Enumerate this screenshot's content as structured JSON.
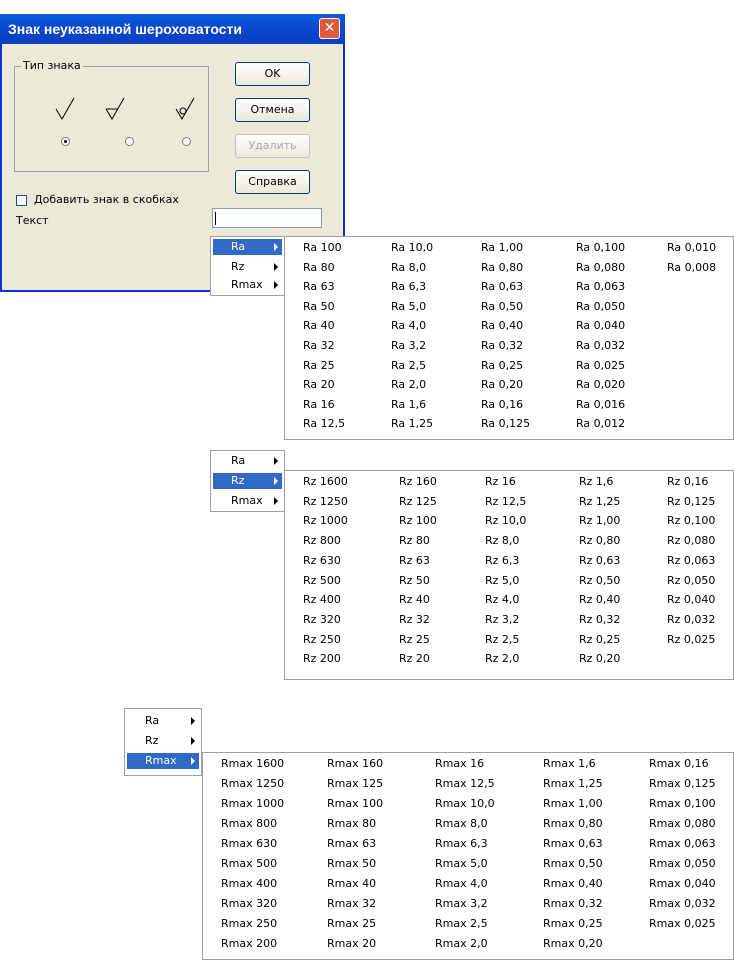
{
  "dialog": {
    "title": "Знак неуказанной шероховатости",
    "group_label": "Тип знака",
    "buttons": {
      "ok": "OK",
      "cancel": "Отмена",
      "delete": "Удалить",
      "help": "Справка"
    },
    "checkbox_label": "Добавить знак в скобках",
    "text_label": "Текст",
    "text_value": ""
  },
  "menus": {
    "items": [
      "Ra",
      "Rz",
      "Rmax"
    ]
  },
  "ra_values": [
    [
      "Ra 100",
      "Ra 10,0",
      "Ra 1,00",
      "Ra 0,100",
      "Ra 0,010"
    ],
    [
      "Ra 80",
      "Ra 8,0",
      "Ra 0,80",
      "Ra 0,080",
      "Ra 0,008"
    ],
    [
      "Ra 63",
      "Ra 6,3",
      "Ra 0,63",
      "Ra 0,063",
      ""
    ],
    [
      "Ra 50",
      "Ra 5,0",
      "Ra 0,50",
      "Ra 0,050",
      ""
    ],
    [
      "Ra 40",
      "Ra 4,0",
      "Ra 0,40",
      "Ra 0,040",
      ""
    ],
    [
      "Ra 32",
      "Ra 3,2",
      "Ra 0,32",
      "Ra 0,032",
      ""
    ],
    [
      "Ra 25",
      "Ra 2,5",
      "Ra 0,25",
      "Ra 0,025",
      ""
    ],
    [
      "Ra 20",
      "Ra 2,0",
      "Ra 0,20",
      "Ra 0,020",
      ""
    ],
    [
      "Ra 16",
      "Ra 1,6",
      "Ra 0,16",
      "Ra 0,016",
      ""
    ],
    [
      "Ra 12,5",
      "Ra 1,25",
      "Ra 0,125",
      "Ra 0,012",
      ""
    ]
  ],
  "rz_values": [
    [
      "Rz 1600",
      "Rz 160",
      "Rz 16",
      "Rz 1,6",
      "Rz 0,16"
    ],
    [
      "Rz 1250",
      "Rz 125",
      "Rz 12,5",
      "Rz 1,25",
      "Rz 0,125"
    ],
    [
      "Rz 1000",
      "Rz 100",
      "Rz 10,0",
      "Rz 1,00",
      "Rz 0,100"
    ],
    [
      "Rz 800",
      "Rz 80",
      "Rz 8,0",
      "Rz 0,80",
      "Rz 0,080"
    ],
    [
      "Rz 630",
      "Rz 63",
      "Rz 6,3",
      "Rz 0,63",
      "Rz 0,063"
    ],
    [
      "Rz 500",
      "Rz 50",
      "Rz 5,0",
      "Rz 0,50",
      "Rz 0,050"
    ],
    [
      "Rz 400",
      "Rz 40",
      "Rz 4,0",
      "Rz 0,40",
      "Rz 0,040"
    ],
    [
      "Rz 320",
      "Rz 32",
      "Rz 3,2",
      "Rz 0,32",
      "Rz 0,032"
    ],
    [
      "Rz 250",
      "Rz 25",
      "Rz 2,5",
      "Rz 0,25",
      "Rz 0,025"
    ],
    [
      "Rz 200",
      "Rz 20",
      "Rz 2,0",
      "Rz 0,20",
      ""
    ]
  ],
  "rmax_values": [
    [
      "Rmax 1600",
      "Rmax 160",
      "Rmax 16",
      "Rmax 1,6",
      "Rmax 0,16"
    ],
    [
      "Rmax 1250",
      "Rmax 125",
      "Rmax 12,5",
      "Rmax 1,25",
      "Rmax 0,125"
    ],
    [
      "Rmax 1000",
      "Rmax 100",
      "Rmax 10,0",
      "Rmax 1,00",
      "Rmax 0,100"
    ],
    [
      "Rmax 800",
      "Rmax 80",
      "Rmax 8,0",
      "Rmax 0,80",
      "Rmax 0,080"
    ],
    [
      "Rmax 630",
      "Rmax 63",
      "Rmax 6,3",
      "Rmax 0,63",
      "Rmax 0,063"
    ],
    [
      "Rmax 500",
      "Rmax 50",
      "Rmax 5,0",
      "Rmax 0,50",
      "Rmax 0,050"
    ],
    [
      "Rmax 400",
      "Rmax 40",
      "Rmax 4,0",
      "Rmax 0,40",
      "Rmax 0,040"
    ],
    [
      "Rmax 320",
      "Rmax 32",
      "Rmax 3,2",
      "Rmax 0,32",
      "Rmax 0,032"
    ],
    [
      "Rmax 250",
      "Rmax 25",
      "Rmax 2,5",
      "Rmax 0,25",
      "Rmax 0,025"
    ],
    [
      "Rmax 200",
      "Rmax 20",
      "Rmax 2,0",
      "Rmax 0,20",
      ""
    ]
  ],
  "colors": {
    "titlebar": "#0a49d0",
    "highlight": "#316ac5",
    "dialog_bg": "#ece9d8"
  }
}
